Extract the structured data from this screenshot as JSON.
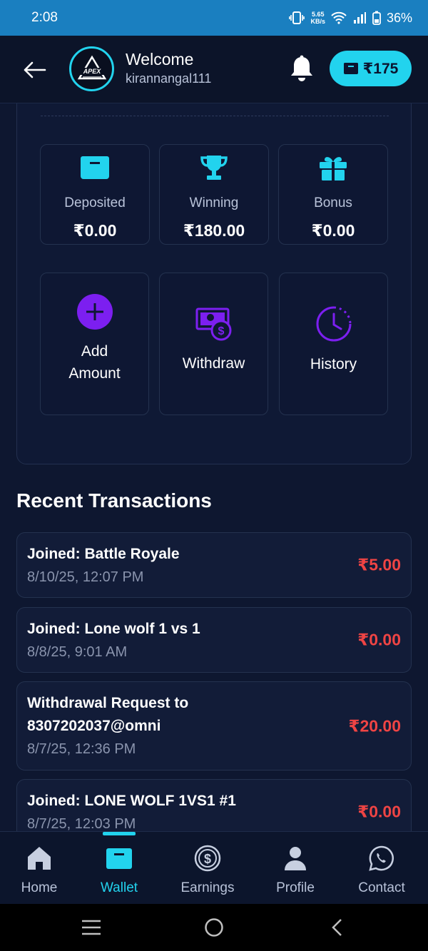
{
  "status_bar": {
    "time": "2:08",
    "net_speed_top": "5.65",
    "net_speed_bottom": "KB/s",
    "battery": "36%"
  },
  "header": {
    "welcome": "Welcome",
    "username": "kirannangal111",
    "balance": "₹175",
    "logo_text": "APEX"
  },
  "balances": [
    {
      "label": "Deposited",
      "value": "₹0.00",
      "icon": "wallet-icon"
    },
    {
      "label": "Winning",
      "value": "₹180.00",
      "icon": "trophy-icon"
    },
    {
      "label": "Bonus",
      "value": "₹0.00",
      "icon": "gift-icon"
    }
  ],
  "actions": {
    "add_line1": "Add",
    "add_line2": "Amount",
    "withdraw": "Withdraw",
    "history": "History"
  },
  "recent_title": "Recent Transactions",
  "transactions": [
    {
      "title": "Joined: Battle Royale",
      "date": "8/10/25, 12:07 PM",
      "amount": "₹5.00"
    },
    {
      "title": "Joined: Lone wolf 1 vs 1",
      "date": "8/8/25, 9:01 AM",
      "amount": "₹0.00"
    },
    {
      "title": "Withdrawal Request to 8307202037@omni",
      "date": "8/7/25, 12:36 PM",
      "amount": "₹20.00"
    },
    {
      "title": "Joined: LONE WOLF 1VS1 #1",
      "date": "8/7/25, 12:03 PM",
      "amount": "₹0.00"
    }
  ],
  "bottom_nav": {
    "home": "Home",
    "wallet": "Wallet",
    "earnings": "Earnings",
    "profile": "Profile",
    "contact": "Contact"
  },
  "colors": {
    "accent": "#22d3ee",
    "purple": "#7c1ff0",
    "negative": "#ef4444",
    "background": "#0e1730"
  }
}
